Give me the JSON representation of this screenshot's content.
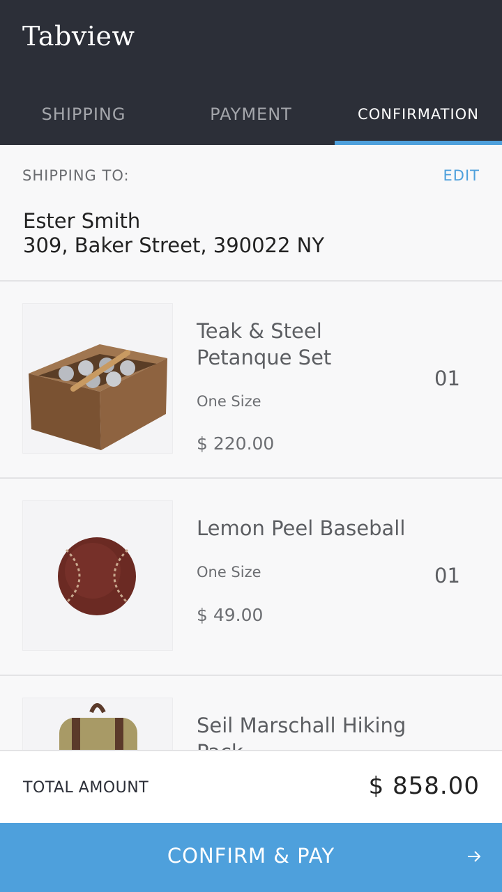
{
  "app": {
    "title": "Tabview"
  },
  "tabs": [
    {
      "label": "SHIPPING",
      "active": false
    },
    {
      "label": "PAYMENT",
      "active": false
    },
    {
      "label": "CONFIRMATION",
      "active": true
    }
  ],
  "shipping": {
    "label": "SHIPPING TO:",
    "edit_label": "EDIT",
    "name": "Ester Smith",
    "address": "309, Baker Street, 390022 NY"
  },
  "items": [
    {
      "name": "Teak & Steel Petanque Set",
      "size": "One Size",
      "price": "$ 220.00",
      "qty": "01",
      "image_icon": "petanque-set-image"
    },
    {
      "name": "Lemon Peel Baseball",
      "size": "One Size",
      "price": "$ 49.00",
      "qty": "01",
      "image_icon": "baseball-image"
    },
    {
      "name": "Seil Marschall Hiking Pack",
      "size": "",
      "price": "",
      "qty": "",
      "image_icon": "hiking-pack-image"
    }
  ],
  "total": {
    "label": "TOTAL AMOUNT",
    "value": "$ 858.00"
  },
  "cta": {
    "label": "CONFIRM & PAY",
    "icon": "arrow-right-icon"
  },
  "colors": {
    "appbar": "#2c2f38",
    "accent": "#4ea0dc",
    "background": "#f8f8f9"
  }
}
